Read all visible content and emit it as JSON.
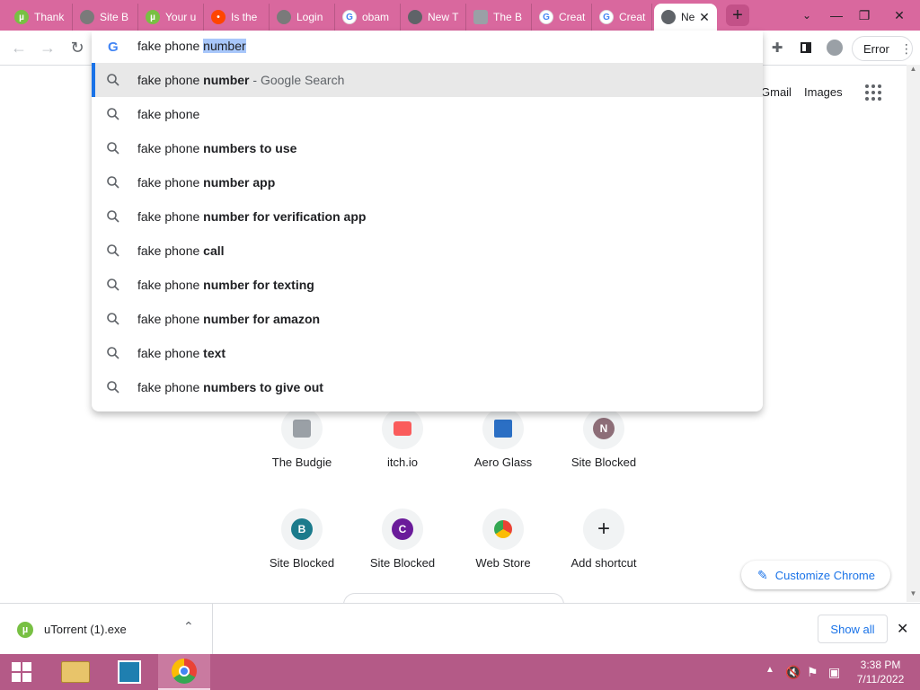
{
  "tabs": [
    {
      "title": "Thank",
      "favicon": "utorrent-icon",
      "color": "#78c043"
    },
    {
      "title": "Site B",
      "favicon": "globe-icon",
      "color": "#7a7a7a"
    },
    {
      "title": "Your u",
      "favicon": "utorrent-icon",
      "color": "#78c043"
    },
    {
      "title": "Is the",
      "favicon": "reddit-icon",
      "color": "#ff4500"
    },
    {
      "title": "Login",
      "favicon": "globe-icon",
      "color": "#7a7a7a"
    },
    {
      "title": "obam",
      "favicon": "google-icon",
      "color": "#4285f4"
    },
    {
      "title": "New T",
      "favicon": "chrome-icon",
      "color": "#5f6368"
    },
    {
      "title": "The B",
      "favicon": "budgie-icon",
      "color": "#9aa0a6"
    },
    {
      "title": "Creat",
      "favicon": "google-icon",
      "color": "#4285f4"
    },
    {
      "title": "Creat",
      "favicon": "google-icon",
      "color": "#4285f4"
    },
    {
      "title": "Ne",
      "favicon": "chrome-icon",
      "color": "#5f6368",
      "active": true
    }
  ],
  "omnibox": {
    "typed": "fake phone ",
    "autocomplete_selected": "number"
  },
  "suggestions": [
    {
      "prefix": "fake phone ",
      "bold": "number",
      "hint": " - Google Search",
      "active": true
    },
    {
      "prefix": "fake phone",
      "bold": "",
      "hint": ""
    },
    {
      "prefix": "fake phone ",
      "bold": "numbers to use",
      "hint": ""
    },
    {
      "prefix": "fake phone ",
      "bold": "number app",
      "hint": ""
    },
    {
      "prefix": "fake phone ",
      "bold": "number for verification app",
      "hint": ""
    },
    {
      "prefix": "fake phone ",
      "bold": "call",
      "hint": ""
    },
    {
      "prefix": "fake phone ",
      "bold": "number for texting",
      "hint": ""
    },
    {
      "prefix": "fake phone ",
      "bold": "number for amazon",
      "hint": ""
    },
    {
      "prefix": "fake phone ",
      "bold": "text",
      "hint": ""
    },
    {
      "prefix": "fake phone ",
      "bold": "numbers to give out",
      "hint": ""
    }
  ],
  "profile": {
    "error_label": "Error"
  },
  "header_links": {
    "gmail": "Gmail",
    "images": "Images"
  },
  "shortcuts": [
    {
      "label": "The Budgie",
      "letter": "",
      "color": "#9aa0a6"
    },
    {
      "label": "itch.io",
      "letter": "",
      "color": "#fa5c5c"
    },
    {
      "label": "Aero Glass",
      "letter": "",
      "color": "#2b6fc4"
    },
    {
      "label": "Site Blocked",
      "letter": "N",
      "color": "#8d6e78"
    },
    {
      "label": "Site Blocked",
      "letter": "B",
      "color": "#1b7b8c"
    },
    {
      "label": "Site Blocked",
      "letter": "C",
      "color": "#6a1b9a"
    },
    {
      "label": "Web Store",
      "letter": "",
      "color": "#34a853"
    },
    {
      "label": "Add shortcut",
      "letter": "+",
      "color": "#f1f3f4"
    }
  ],
  "customize": {
    "label": "Customize Chrome"
  },
  "download": {
    "filename": "uTorrent (1).exe",
    "show_all": "Show all"
  },
  "clock": {
    "time": "3:38 PM",
    "date": "7/11/2022"
  },
  "colors": {
    "tabbar": "#d9689e",
    "taskbar": "#b45a87",
    "accent": "#1a73e8"
  }
}
